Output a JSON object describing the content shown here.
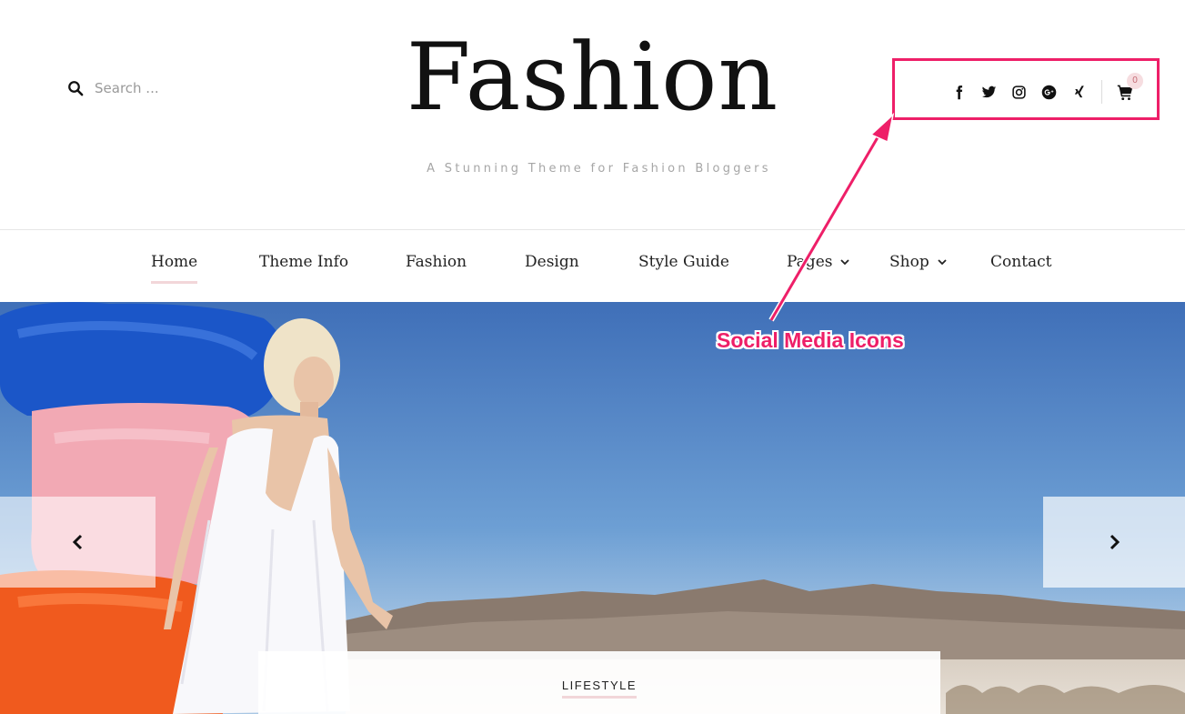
{
  "header": {
    "search_placeholder": "Search ...",
    "site_title": "Fashion",
    "tagline": "A Stunning Theme for Fashion Bloggers",
    "social_icons": [
      "facebook-icon",
      "twitter-icon",
      "instagram-icon",
      "google-plus-icon",
      "xing-icon"
    ],
    "cart_count": "0"
  },
  "annotation": {
    "label": "Social Media Icons",
    "color": "#ee1f68"
  },
  "nav": {
    "items": [
      {
        "label": "Home",
        "active": true
      },
      {
        "label": "Theme Info"
      },
      {
        "label": "Fashion"
      },
      {
        "label": "Design"
      },
      {
        "label": "Style Guide"
      },
      {
        "label": "Pages",
        "dropdown": true
      },
      {
        "label": "Shop",
        "dropdown": true
      },
      {
        "label": "Contact"
      }
    ]
  },
  "slider": {
    "category": "LIFESTYLE",
    "prev_icon": "chevron-left-icon",
    "next_icon": "chevron-right-icon"
  },
  "colors": {
    "accent_underline": "#f2d6d9",
    "text": "#222222",
    "muted": "#a6a6a6"
  }
}
